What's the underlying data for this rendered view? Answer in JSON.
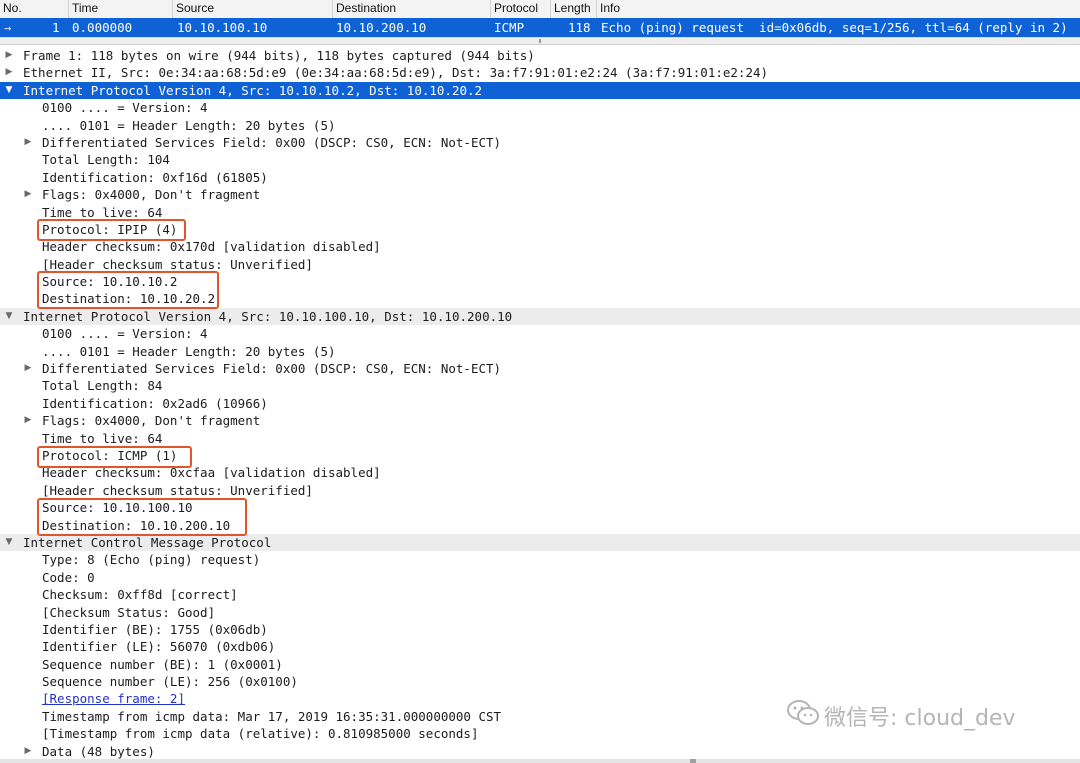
{
  "packet_list": {
    "columns": [
      "No.",
      "Time",
      "Source",
      "Destination",
      "Protocol",
      "Length",
      "Info"
    ],
    "selected_row": {
      "no": "1",
      "time": "0.000000",
      "source": "10.10.100.10",
      "destination": "10.10.200.10",
      "protocol": "ICMP",
      "length": "118",
      "info": "Echo (ping) request  id=0x06db, seq=1/256, ttl=64 (reply in 2)"
    }
  },
  "details": {
    "frame": "Frame 1: 118 bytes on wire (944 bits), 118 bytes captured (944 bits)",
    "ethernet": "Ethernet II, Src: 0e:34:aa:68:5d:e9 (0e:34:aa:68:5d:e9), Dst: 3a:f7:91:01:e2:24 (3a:f7:91:01:e2:24)",
    "ip_outer": {
      "header": "Internet Protocol Version 4, Src: 10.10.10.2, Dst: 10.10.20.2",
      "version": "0100 .... = Version: 4",
      "header_length": ".... 0101 = Header Length: 20 bytes (5)",
      "dsfield": "Differentiated Services Field: 0x00 (DSCP: CS0, ECN: Not-ECT)",
      "total_length": "Total Length: 104",
      "identification": "Identification: 0xf16d (61805)",
      "flags": "Flags: 0x4000, Don't fragment",
      "ttl": "Time to live: 64",
      "protocol": "Protocol: IPIP (4)",
      "checksum": "Header checksum: 0x170d [validation disabled]",
      "checksum_status": "[Header checksum status: Unverified]",
      "source": "Source: 10.10.10.2",
      "destination": "Destination: 10.10.20.2"
    },
    "ip_inner": {
      "header": "Internet Protocol Version 4, Src: 10.10.100.10, Dst: 10.10.200.10",
      "version": "0100 .... = Version: 4",
      "header_length": ".... 0101 = Header Length: 20 bytes (5)",
      "dsfield": "Differentiated Services Field: 0x00 (DSCP: CS0, ECN: Not-ECT)",
      "total_length": "Total Length: 84",
      "identification": "Identification: 0x2ad6 (10966)",
      "flags": "Flags: 0x4000, Don't fragment",
      "ttl": "Time to live: 64",
      "protocol": "Protocol: ICMP (1)",
      "checksum": "Header checksum: 0xcfaa [validation disabled]",
      "checksum_status": "[Header checksum status: Unverified]",
      "source": "Source: 10.10.100.10",
      "destination": "Destination: 10.10.200.10"
    },
    "icmp": {
      "header": "Internet Control Message Protocol",
      "type": "Type: 8 (Echo (ping) request)",
      "code": "Code: 0",
      "checksum": "Checksum: 0xff8d [correct]",
      "checksum_status": "[Checksum Status: Good]",
      "id_be": "Identifier (BE): 1755 (0x06db)",
      "id_le": "Identifier (LE): 56070 (0xdb06)",
      "seq_be": "Sequence number (BE): 1 (0x0001)",
      "seq_le": "Sequence number (LE): 256 (0x0100)",
      "response_frame": "[Response frame: 2]",
      "timestamp": "Timestamp from icmp data: Mar 17, 2019 16:35:31.000000000 CST",
      "timestamp_relative": "[Timestamp from icmp data (relative): 0.810985000 seconds]",
      "data": "Data (48 bytes)"
    }
  },
  "watermark": "微信号: cloud_dev",
  "colors": {
    "selection": "#0f62d6",
    "highlight_box": "#e2552a",
    "section_bg": "#ececec",
    "link": "#2233c8"
  }
}
